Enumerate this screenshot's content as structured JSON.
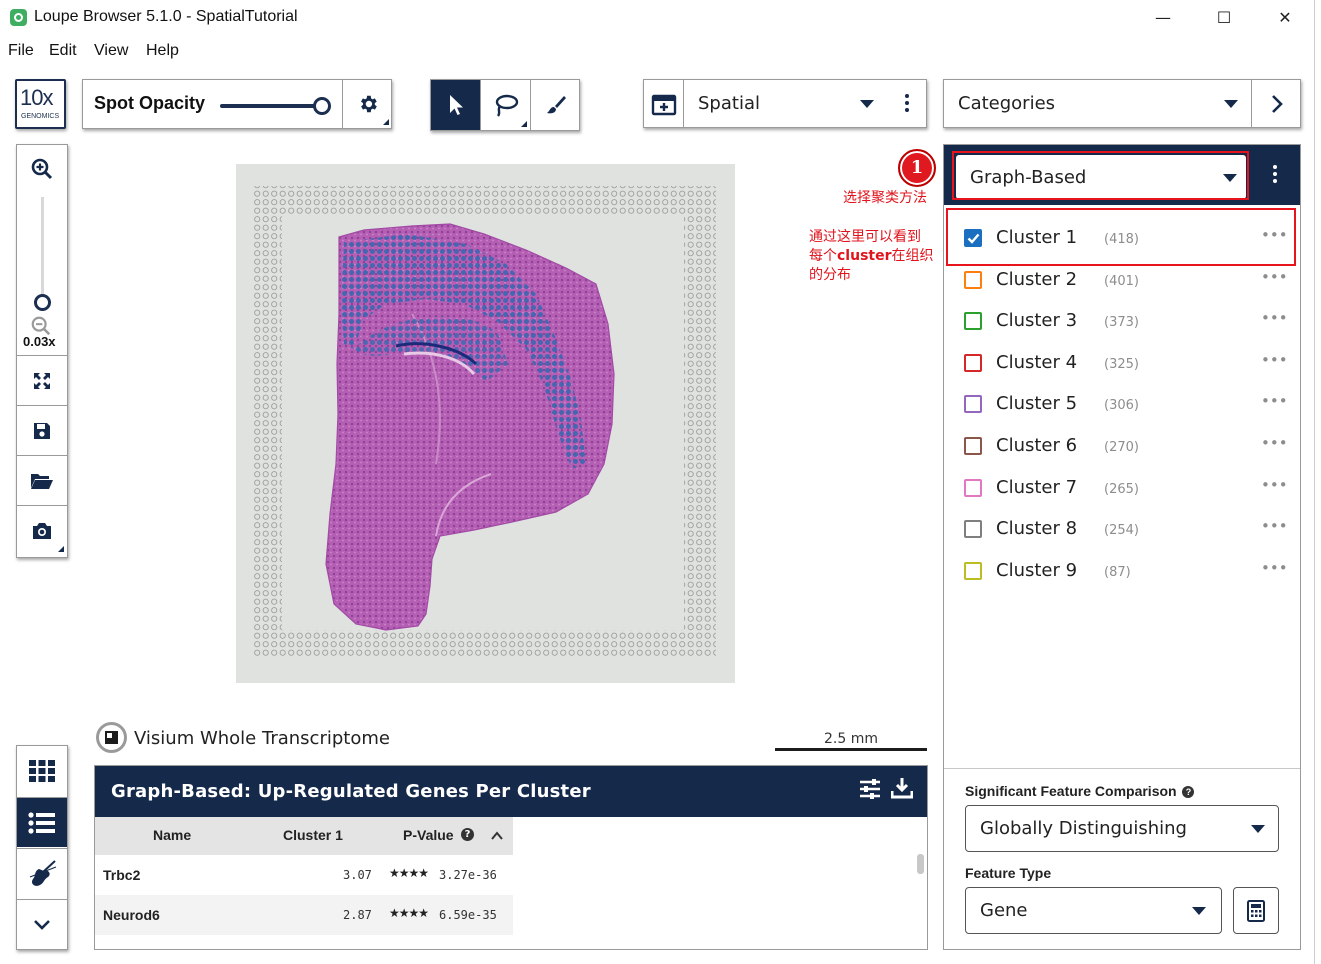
{
  "window": {
    "title": "Loupe Browser 5.1.0 - SpatialTutorial",
    "controls": {
      "minimize": "—",
      "maximize": "☐",
      "close": "✕"
    }
  },
  "menu": [
    "File",
    "Edit",
    "View",
    "Help"
  ],
  "logo": {
    "mark": "10x",
    "sub": "GENOMICS"
  },
  "toolbar": {
    "spot_opacity_label": "Spot Opacity",
    "spot_opacity_level": 1.0,
    "view_select": "Spatial",
    "categories_select": "Categories"
  },
  "zoom": {
    "level": "0.03x"
  },
  "viewer": {
    "assay_label": "Visium Whole Transcriptome",
    "scale_text": "2.5 mm"
  },
  "gene_table": {
    "title": "Graph-Based: Up-Regulated Genes Per Cluster",
    "columns": [
      "Name",
      "Cluster 1",
      "P-Value"
    ],
    "rows": [
      {
        "name": "Trbc2",
        "value": "3.07",
        "stars": "★★★★",
        "pvalue": "3.27e-36"
      },
      {
        "name": "Neurod6",
        "value": "2.87",
        "stars": "★★★★",
        "pvalue": "6.59e-35"
      }
    ]
  },
  "clusters": {
    "method": "Graph-Based",
    "items": [
      {
        "name": "Cluster 1",
        "count": "(418)",
        "color": "#1f77b4",
        "checked": true
      },
      {
        "name": "Cluster 2",
        "count": "(401)",
        "color": "#ff7f0e",
        "checked": false
      },
      {
        "name": "Cluster 3",
        "count": "(373)",
        "color": "#2ca02c",
        "checked": false
      },
      {
        "name": "Cluster 4",
        "count": "(325)",
        "color": "#d62728",
        "checked": false
      },
      {
        "name": "Cluster 5",
        "count": "(306)",
        "color": "#9467bd",
        "checked": false
      },
      {
        "name": "Cluster 6",
        "count": "(270)",
        "color": "#8c564b",
        "checked": false
      },
      {
        "name": "Cluster 7",
        "count": "(265)",
        "color": "#e377c2",
        "checked": false
      },
      {
        "name": "Cluster 8",
        "count": "(254)",
        "color": "#7f7f7f",
        "checked": false
      },
      {
        "name": "Cluster 9",
        "count": "(87)",
        "color": "#bcbd22",
        "checked": false
      }
    ],
    "significant_feature_label": "Significant Feature Comparison",
    "significant_feature_value": "Globally Distinguishing",
    "feature_type_label": "Feature Type",
    "feature_type_value": "Gene"
  },
  "annotations": {
    "badge": "1",
    "note1": "选择聚类方法",
    "note2_line1": "通过这里可以看到",
    "note2_line2a": "每个",
    "note2_line2b": "cluster",
    "note2_line2c": "在组织",
    "note2_line3": "的分布"
  }
}
